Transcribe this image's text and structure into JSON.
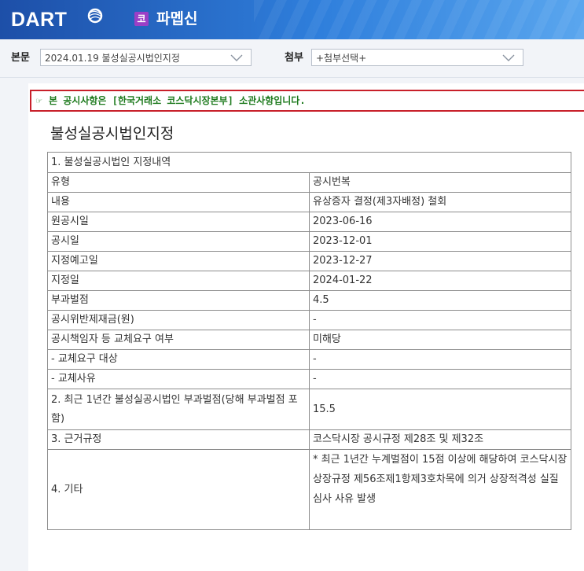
{
  "header": {
    "logo_text": "DART",
    "corp_badge": "코",
    "corp_name": "파멥신",
    "brand_color": "#1d4fa8"
  },
  "toolbar": {
    "main_label": "본문",
    "main_select_value": "2024.01.19  불성실공시법인지정",
    "attach_label": "첨부",
    "attach_select_value": "+첨부선택+"
  },
  "notice": {
    "text": "본 공시사항은 [한국거래소 코스닥시장본부] 소관사항입니다.",
    "border_color": "#c8202a",
    "text_color": "#1d7a1d"
  },
  "document": {
    "title": "불성실공시법인지정",
    "section1_header": "1. 불성실공시법인 지정내역",
    "rows": [
      {
        "label": "유형",
        "value": "공시번복"
      },
      {
        "label": "내용",
        "value": "유상증자 결정(제3자배정) 철회"
      },
      {
        "label": "원공시일",
        "value": "2023-06-16"
      },
      {
        "label": "공시일",
        "value": "2023-12-01"
      },
      {
        "label": "지정예고일",
        "value": "2023-12-27"
      },
      {
        "label": "지정일",
        "value": "2024-01-22"
      },
      {
        "label": "부과벌점",
        "value": "4.5"
      },
      {
        "label": "공시위반제재금(원)",
        "value": "-"
      },
      {
        "label": "공시책임자 등 교체요구 여부",
        "value": "미해당"
      },
      {
        "label": "- 교체요구 대상",
        "value": "-"
      },
      {
        "label": "- 교체사유",
        "value": "-"
      },
      {
        "label": "2. 최근 1년간 불성실공시법인 부과벌점(당해 부과벌점 포함)",
        "value": "15.5"
      },
      {
        "label": "3. 근거규정",
        "value": "코스닥시장 공시규정 제28조 및 제32조"
      },
      {
        "label": "4. 기타",
        "value": "* 최근 1년간 누계벌점이 15점 이상에 해당하여 코스닥시장상장규정 제56조제1항제3호차목에 의거 상장적격성 실질심사 사유 발생"
      }
    ]
  }
}
